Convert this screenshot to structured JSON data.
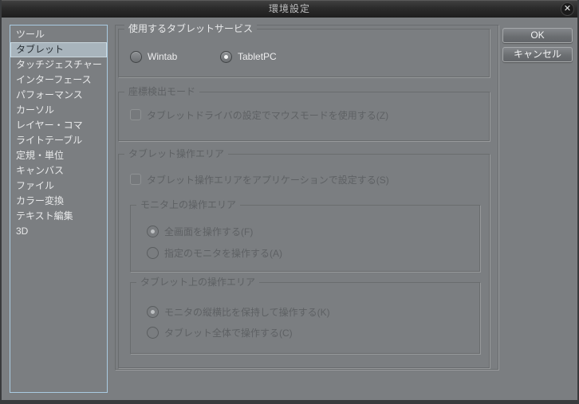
{
  "title_bar": {
    "title": "環境設定",
    "close_glyph": "✕"
  },
  "sidebar": {
    "items": [
      {
        "label": "ツール",
        "selected": false
      },
      {
        "label": "タブレット",
        "selected": true
      },
      {
        "label": "タッチジェスチャー",
        "selected": false
      },
      {
        "label": "インターフェース",
        "selected": false
      },
      {
        "label": "パフォーマンス",
        "selected": false
      },
      {
        "label": "カーソル",
        "selected": false
      },
      {
        "label": "レイヤー・コマ",
        "selected": false
      },
      {
        "label": "ライトテーブル",
        "selected": false
      },
      {
        "label": "定規・単位",
        "selected": false
      },
      {
        "label": "キャンバス",
        "selected": false
      },
      {
        "label": "ファイル",
        "selected": false
      },
      {
        "label": "カラー変換",
        "selected": false
      },
      {
        "label": "テキスト編集",
        "selected": false
      },
      {
        "label": "3D",
        "selected": false
      }
    ]
  },
  "panel": {
    "groups": [
      {
        "label": "使用するタブレットサービス",
        "enabled": true,
        "radios": [
          {
            "label": "Wintab",
            "selected": false
          },
          {
            "label": "TabletPC",
            "selected": true
          }
        ]
      },
      {
        "label": "座標検出モード",
        "enabled": false,
        "checkbox": {
          "label": "タブレットドライバの設定でマウスモードを使用する(Z)",
          "checked": false
        }
      },
      {
        "label": "タブレット操作エリア",
        "enabled": false,
        "checkbox": {
          "label": "タブレット操作エリアをアプリケーションで設定する(S)",
          "checked": false
        },
        "subgroups": [
          {
            "label": "モニタ上の操作エリア",
            "radios": [
              {
                "label": "全画面を操作する(F)",
                "selected": true
              },
              {
                "label": "指定のモニタを操作する(A)",
                "selected": false
              }
            ]
          },
          {
            "label": "タブレット上の操作エリア",
            "radios": [
              {
                "label": "モニタの縦横比を保持して操作する(K)",
                "selected": true
              },
              {
                "label": "タブレット全体で操作する(C)",
                "selected": false
              }
            ]
          }
        ]
      }
    ]
  },
  "buttons": {
    "ok": "OK",
    "cancel": "キャンセル"
  },
  "colors": {
    "dialog_bg": "#7b7e81",
    "titlebar_bg": "#2b2b2b",
    "frame_border": "#393b3d",
    "sidebar_focus_border": "#a9cbe2",
    "selected_item_bg": "#a8b4bc",
    "enabled_text": "#ededee",
    "disabled_text": "#5e6164",
    "radio_dot": "#f4f5f5"
  }
}
